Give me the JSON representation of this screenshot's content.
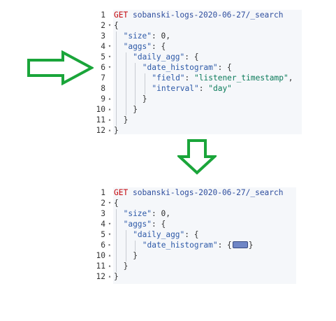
{
  "top_editor": {
    "lines": [
      {
        "n": "1",
        "fold": "",
        "indent": 0,
        "tokens": [
          {
            "t": "GET",
            "c": "kw-method"
          },
          {
            "t": " ",
            "c": ""
          },
          {
            "t": "sobanski-logs-2020-06-27/_search",
            "c": "kw-url"
          }
        ]
      },
      {
        "n": "2",
        "fold": "▾",
        "indent": 0,
        "tokens": [
          {
            "t": "{",
            "c": "tok-punc"
          }
        ]
      },
      {
        "n": "3",
        "fold": "",
        "indent": 1,
        "tokens": [
          {
            "t": "\"size\"",
            "c": "tok-key"
          },
          {
            "t": ": ",
            "c": "tok-punc"
          },
          {
            "t": "0",
            "c": "tok-num"
          },
          {
            "t": ",",
            "c": "tok-punc"
          }
        ]
      },
      {
        "n": "4",
        "fold": "▾",
        "indent": 1,
        "tokens": [
          {
            "t": "\"aggs\"",
            "c": "tok-key"
          },
          {
            "t": ": {",
            "c": "tok-punc"
          }
        ]
      },
      {
        "n": "5",
        "fold": "▾",
        "indent": 2,
        "tokens": [
          {
            "t": "\"daily_agg\"",
            "c": "tok-key"
          },
          {
            "t": ": {",
            "c": "tok-punc"
          }
        ]
      },
      {
        "n": "6",
        "fold": "▾",
        "indent": 3,
        "tokens": [
          {
            "t": "\"date_histogram\"",
            "c": "tok-key"
          },
          {
            "t": ": {",
            "c": "tok-punc"
          }
        ]
      },
      {
        "n": "7",
        "fold": "",
        "indent": 4,
        "tokens": [
          {
            "t": "\"field\"",
            "c": "tok-key"
          },
          {
            "t": ": ",
            "c": "tok-punc"
          },
          {
            "t": "\"listener_timestamp\"",
            "c": "tok-str"
          },
          {
            "t": ",",
            "c": "tok-punc"
          }
        ]
      },
      {
        "n": "8",
        "fold": "",
        "indent": 4,
        "tokens": [
          {
            "t": "\"interval\"",
            "c": "tok-key"
          },
          {
            "t": ": ",
            "c": "tok-punc"
          },
          {
            "t": "\"day\"",
            "c": "tok-str"
          }
        ]
      },
      {
        "n": "9",
        "fold": "▴",
        "indent": 3,
        "tokens": [
          {
            "t": "}",
            "c": "tok-punc"
          }
        ]
      },
      {
        "n": "10",
        "fold": "▴",
        "indent": 2,
        "tokens": [
          {
            "t": "}",
            "c": "tok-punc"
          }
        ]
      },
      {
        "n": "11",
        "fold": "▴",
        "indent": 1,
        "tokens": [
          {
            "t": "}",
            "c": "tok-punc"
          }
        ]
      },
      {
        "n": "12",
        "fold": "▴",
        "indent": 0,
        "tokens": [
          {
            "t": "}",
            "c": "tok-punc"
          }
        ]
      }
    ]
  },
  "bottom_editor": {
    "lines": [
      {
        "n": "1",
        "fold": "",
        "indent": 0,
        "tokens": [
          {
            "t": "GET",
            "c": "kw-method"
          },
          {
            "t": " ",
            "c": ""
          },
          {
            "t": "sobanski-logs-2020-06-27/_search",
            "c": "kw-url"
          }
        ]
      },
      {
        "n": "2",
        "fold": "▾",
        "indent": 0,
        "tokens": [
          {
            "t": "{",
            "c": "tok-punc"
          }
        ]
      },
      {
        "n": "3",
        "fold": "",
        "indent": 1,
        "tokens": [
          {
            "t": "\"size\"",
            "c": "tok-key"
          },
          {
            "t": ": ",
            "c": "tok-punc"
          },
          {
            "t": "0",
            "c": "tok-num"
          },
          {
            "t": ",",
            "c": "tok-punc"
          }
        ]
      },
      {
        "n": "4",
        "fold": "▾",
        "indent": 1,
        "tokens": [
          {
            "t": "\"aggs\"",
            "c": "tok-key"
          },
          {
            "t": ": {",
            "c": "tok-punc"
          }
        ]
      },
      {
        "n": "5",
        "fold": "▾",
        "indent": 2,
        "tokens": [
          {
            "t": "\"daily_agg\"",
            "c": "tok-key"
          },
          {
            "t": ": {",
            "c": "tok-punc"
          }
        ]
      },
      {
        "n": "6",
        "fold": "▸",
        "indent": 3,
        "collapsed": true,
        "tokens": [
          {
            "t": "\"date_histogram\"",
            "c": "tok-key"
          },
          {
            "t": ": {",
            "c": "tok-punc"
          }
        ],
        "after": "}"
      },
      {
        "n": "10",
        "fold": "▴",
        "indent": 2,
        "tokens": [
          {
            "t": "}",
            "c": "tok-punc"
          }
        ]
      },
      {
        "n": "11",
        "fold": "▴",
        "indent": 1,
        "tokens": [
          {
            "t": "}",
            "c": "tok-punc"
          }
        ]
      },
      {
        "n": "12",
        "fold": "▴",
        "indent": 0,
        "tokens": [
          {
            "t": "}",
            "c": "tok-punc"
          }
        ]
      }
    ]
  },
  "colors": {
    "arrow_green": "#1aa53a",
    "panel_bg": "#f5f7fa",
    "method_red": "#c5060b",
    "url_blue": "#2e4e9e",
    "string_green": "#0b7b5a",
    "collapsed_marker": "#6f86c6"
  },
  "icons": {
    "right_arrow": "right-arrow-icon",
    "down_arrow": "down-arrow-icon"
  }
}
